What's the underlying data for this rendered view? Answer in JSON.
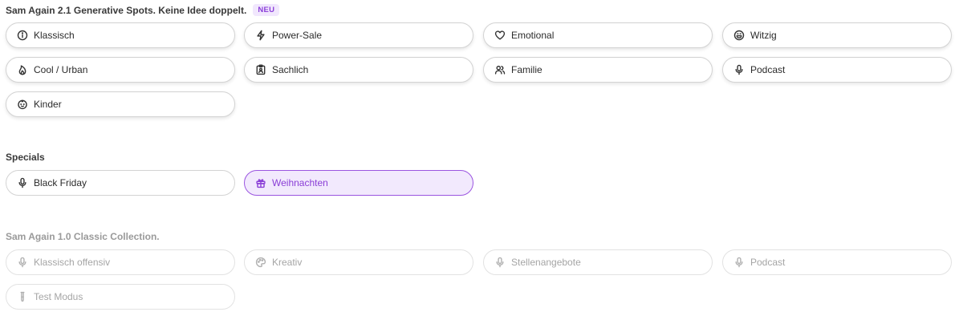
{
  "generative": {
    "title": "Sam Again 2.1 Generative Spots. Keine Idee doppelt.",
    "badge": "NEU",
    "items": [
      {
        "label": "Klassisch",
        "icon": "info-icon"
      },
      {
        "label": "Power-Sale",
        "icon": "lightning-icon"
      },
      {
        "label": "Emotional",
        "icon": "heart-icon"
      },
      {
        "label": "Witzig",
        "icon": "laugh-icon"
      },
      {
        "label": "Cool / Urban",
        "icon": "flame-icon"
      },
      {
        "label": "Sachlich",
        "icon": "clipboard-user-icon"
      },
      {
        "label": "Familie",
        "icon": "users-icon"
      },
      {
        "label": "Podcast",
        "icon": "microphone-icon"
      },
      {
        "label": "Kinder",
        "icon": "baby-face-icon"
      }
    ]
  },
  "specials": {
    "title": "Specials",
    "items": [
      {
        "label": "Black Friday",
        "icon": "microphone-icon"
      },
      {
        "label": "Weihnachten",
        "icon": "gift-icon",
        "selected": true
      }
    ]
  },
  "classic": {
    "title": "Sam Again 1.0 Classic Collection.",
    "items": [
      {
        "label": "Klassisch offensiv",
        "icon": "microphone-icon"
      },
      {
        "label": "Kreativ",
        "icon": "palette-icon"
      },
      {
        "label": "Stellenangebote",
        "icon": "microphone-icon"
      },
      {
        "label": "Podcast",
        "icon": "microphone-icon"
      },
      {
        "label": "Test Modus",
        "icon": "test-tube-icon"
      }
    ]
  },
  "colors": {
    "accent": "#8a3ed6",
    "accent_bg": "#f2e9fd",
    "badge_bg": "#f1e7fd"
  }
}
